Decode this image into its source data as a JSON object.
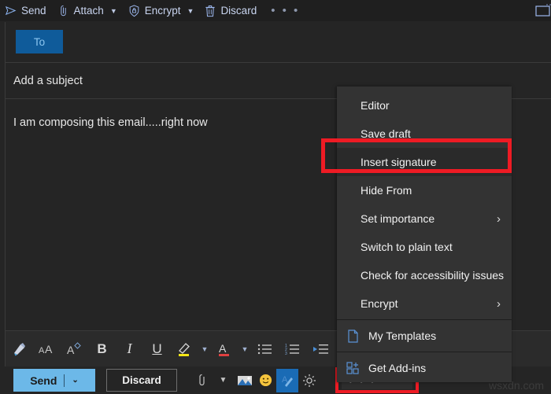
{
  "window": {
    "popout_icon": "popout-window-icon"
  },
  "topbar": {
    "commands": [
      {
        "label": "Send",
        "icon": "send-paperplane-icon",
        "caret": false
      },
      {
        "label": "Attach",
        "icon": "paperclip-icon",
        "caret": true
      },
      {
        "label": "Encrypt",
        "icon": "shield-lock-icon",
        "caret": true
      },
      {
        "label": "Discard",
        "icon": "trash-icon",
        "caret": false
      }
    ],
    "overflow_label": "• • •"
  },
  "compose": {
    "to_label": "To",
    "subject_placeholder": "Add a subject",
    "body_text": "I am composing this email.....right now"
  },
  "format_toolbar": {
    "items": [
      {
        "name": "format-painter-icon",
        "glyph": "painter"
      },
      {
        "name": "font-size-icon",
        "glyph": "AA"
      },
      {
        "name": "font-options-icon",
        "glyph": "Adiamond"
      },
      {
        "name": "bold-button",
        "glyph": "B"
      },
      {
        "name": "italic-button",
        "glyph": "I"
      },
      {
        "name": "underline-button",
        "glyph": "U"
      },
      {
        "name": "highlight-color-icon",
        "glyph": "highlight"
      },
      {
        "name": "highlight-caret",
        "glyph": "caret"
      },
      {
        "name": "font-color-icon",
        "glyph": "fontcolor"
      },
      {
        "name": "font-color-caret",
        "glyph": "caret"
      },
      {
        "name": "bulleted-list-icon",
        "glyph": "bullets"
      },
      {
        "name": "numbered-list-icon",
        "glyph": "numbers"
      },
      {
        "name": "decrease-indent-icon",
        "glyph": "outdent"
      }
    ]
  },
  "action_bar": {
    "send_label": "Send",
    "send_caret": "⌄",
    "discard_label": "Discard",
    "icons": [
      {
        "name": "attach-clip-icon",
        "glyph": "clip"
      },
      {
        "name": "attach-caret-icon",
        "glyph": "caret"
      },
      {
        "name": "insert-picture-icon",
        "glyph": "picture"
      },
      {
        "name": "emoji-icon",
        "glyph": "emoji"
      },
      {
        "name": "insert-signature-icon",
        "glyph": "signature",
        "highlighted": true
      },
      {
        "name": "dictate-icon",
        "glyph": "sun"
      }
    ],
    "more_options_label": "• • •"
  },
  "context_menu": {
    "items": [
      {
        "label": "Editor",
        "submenu": false,
        "selected": false,
        "icon": null
      },
      {
        "label": "Save draft",
        "submenu": false,
        "selected": false,
        "icon": null
      },
      {
        "label": "Insert signature",
        "submenu": false,
        "selected": true,
        "icon": null
      },
      {
        "label": "Hide From",
        "submenu": false,
        "selected": false,
        "icon": null
      },
      {
        "label": "Set importance",
        "submenu": true,
        "selected": false,
        "icon": null
      },
      {
        "label": "Switch to plain text",
        "submenu": false,
        "selected": false,
        "icon": null
      },
      {
        "label": "Check for accessibility issues",
        "submenu": false,
        "selected": false,
        "icon": null
      },
      {
        "label": "Encrypt",
        "submenu": true,
        "selected": false,
        "icon": null
      },
      {
        "label": "My Templates",
        "submenu": false,
        "selected": false,
        "icon": "document-icon",
        "sep_before": true
      },
      {
        "label": "Get Add-ins",
        "submenu": false,
        "selected": false,
        "icon": "addins-grid-icon",
        "sep_before": true
      }
    ],
    "submenu_arrow": "›"
  },
  "annotation": {
    "highlight_color": "#ee1b24"
  },
  "watermark": {
    "text": "wsxdn.com"
  }
}
